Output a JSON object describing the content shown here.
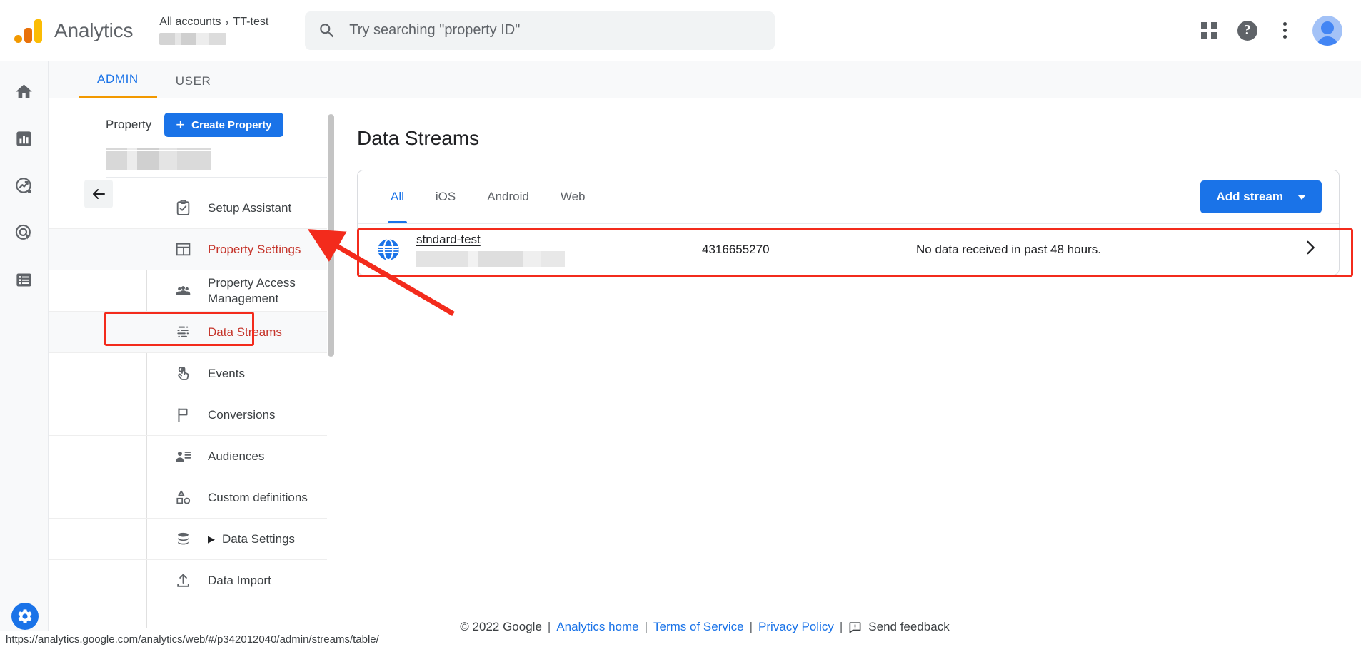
{
  "topbar": {
    "brand": "Analytics",
    "logo_icon": "analytics-logo-icon",
    "breadcrumb": {
      "root": "All accounts",
      "separator": "›",
      "current": "TT-test"
    },
    "search": {
      "placeholder": "Try searching \"property ID\"",
      "value": "",
      "icon": "search-icon"
    },
    "apps_icon": "apps-grid-icon",
    "help_icon": "help-question-icon",
    "help_glyph": "?",
    "more_icon": "more-vertical-icon",
    "avatar_icon": "user-avatar-icon"
  },
  "rail": {
    "items": [
      {
        "name": "home",
        "icon": "home-icon"
      },
      {
        "name": "reports",
        "icon": "bar-chart-icon"
      },
      {
        "name": "explore",
        "icon": "explore-compass-icon"
      },
      {
        "name": "advertising",
        "icon": "advertising-target-icon"
      },
      {
        "name": "configure",
        "icon": "list-icon"
      }
    ],
    "gear": {
      "name": "admin-settings",
      "icon": "gear-icon"
    }
  },
  "admin_tabs": [
    {
      "label": "ADMIN",
      "active": true
    },
    {
      "label": "USER",
      "active": false
    }
  ],
  "nav": {
    "section_label": "Property",
    "create_button": {
      "label": "Create Property",
      "plus": "+"
    },
    "collapse_icon": "arrow-left-icon",
    "property_name_redacted": true,
    "items": [
      {
        "label": "Setup Assistant",
        "icon": "checklist-icon",
        "state": "normal"
      },
      {
        "label": "Property Settings",
        "icon": "layout-panel-icon",
        "state": "selected"
      },
      {
        "label": "Property Access Management",
        "icon": "people-icon",
        "state": "normal"
      },
      {
        "label": "Data Streams",
        "icon": "data-streams-icon",
        "state": "highlighted"
      },
      {
        "label": "Events",
        "icon": "tap-finger-icon",
        "state": "normal"
      },
      {
        "label": "Conversions",
        "icon": "flag-icon",
        "state": "normal"
      },
      {
        "label": "Audiences",
        "icon": "audience-person-list-icon",
        "state": "normal"
      },
      {
        "label": "Custom definitions",
        "icon": "shapes-icon",
        "state": "normal"
      },
      {
        "label": "Data Settings",
        "icon": "database-icon",
        "state": "normal",
        "expander": "▶"
      },
      {
        "label": "Data Import",
        "icon": "upload-icon",
        "state": "normal"
      }
    ]
  },
  "main": {
    "title": "Data Streams",
    "tabs": [
      {
        "label": "All",
        "active": true
      },
      {
        "label": "iOS",
        "active": false
      },
      {
        "label": "Android",
        "active": false
      },
      {
        "label": "Web",
        "active": false
      }
    ],
    "add_stream_button": {
      "label": "Add stream",
      "caret": "▾"
    },
    "streams": [
      {
        "icon": "web-globe-icon",
        "name": "stndard-test",
        "url_redacted": true,
        "id": "4316655270",
        "status": "No data received in past 48 hours.",
        "chevron": "›"
      }
    ]
  },
  "annotations": {
    "nav_box_color": "#f32b1c",
    "row_box_color": "#f32b1c",
    "arrow_color": "#f32b1c"
  },
  "footer": {
    "copyright": "© 2022 Google",
    "pipe": "|",
    "links": [
      "Analytics home",
      "Terms of Service",
      "Privacy Policy"
    ],
    "feedback": {
      "label": "Send feedback",
      "icon": "feedback-icon"
    }
  },
  "status_url": "https://analytics.google.com/analytics/web/#/p342012040/admin/streams/table/"
}
